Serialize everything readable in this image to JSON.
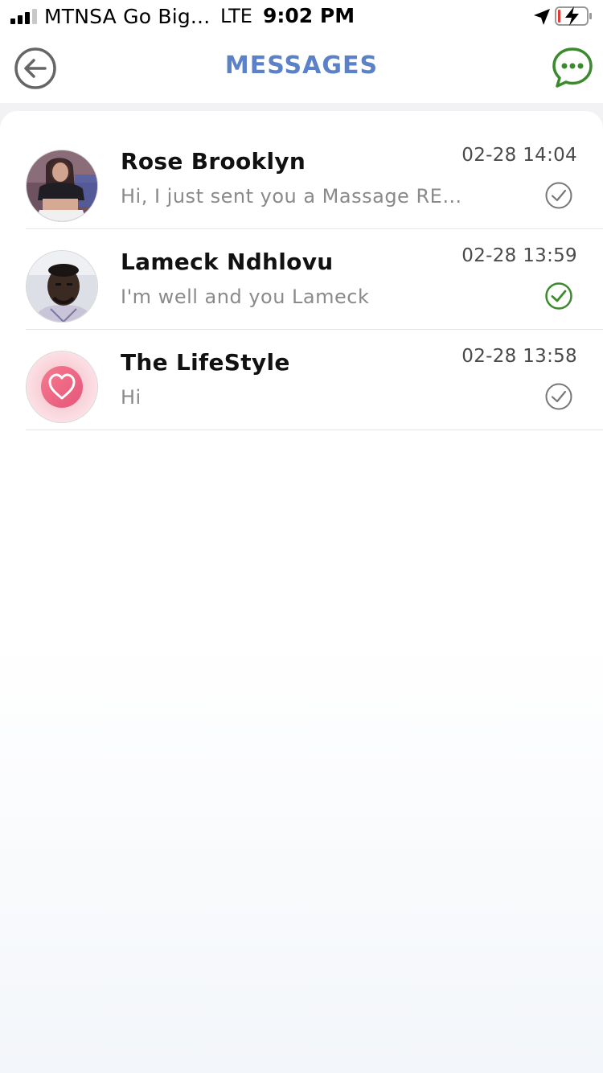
{
  "status_bar": {
    "carrier": "MTNSA Go Big...",
    "network": "LTE",
    "time": "9:02 PM",
    "signal_icon": "signal-bars-icon",
    "location_icon": "location-arrow-icon",
    "battery_icon": "battery-charging-icon"
  },
  "header": {
    "title": "MESSAGES",
    "back_icon": "back-arrow-icon",
    "new_message_icon": "chat-bubble-icon"
  },
  "colors": {
    "title": "#5b82c9",
    "accent_green": "#3c8a2e",
    "read_gray": "#777777"
  },
  "conversations": [
    {
      "name": "Rose Brooklyn",
      "preview": "Hi, I just sent you a Massage REQ...",
      "time": "02-28 14:04",
      "status_icon": "check-circle-icon",
      "status_color": "#777777"
    },
    {
      "name": "Lameck Ndhlovu",
      "preview": "I'm well and you Lameck",
      "time": "02-28 13:59",
      "status_icon": "check-circle-icon",
      "status_color": "#3c8a2e"
    },
    {
      "name": "The LifeStyle",
      "preview": "Hi",
      "time": "02-28 13:58",
      "status_icon": "check-circle-icon",
      "status_color": "#777777"
    }
  ]
}
